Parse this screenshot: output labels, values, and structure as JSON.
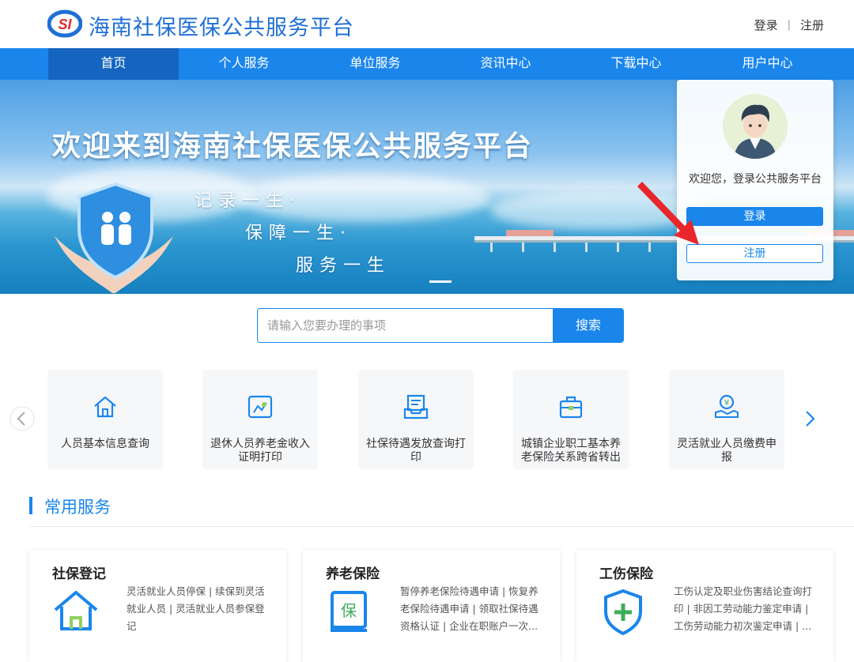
{
  "header": {
    "title": "海南社保医保公共服务平台",
    "logo_text": "SI",
    "login": "登录",
    "separator": "|",
    "register": "注册"
  },
  "nav": {
    "items": [
      "首页",
      "个人服务",
      "单位服务",
      "资讯中心",
      "下载中心",
      "用户中心"
    ],
    "active_index": 0
  },
  "banner": {
    "title": "欢迎来到海南社保医保公共服务平台",
    "slogans": [
      "记录一生·",
      "保障一生·",
      "服务一生"
    ]
  },
  "login_card": {
    "welcome": "欢迎您，登录公共服务平台",
    "login_button": "登录",
    "register_button": "注册"
  },
  "search": {
    "placeholder": "请输入您要办理的事项",
    "button": "搜索"
  },
  "quick_services": [
    {
      "label": "人员基本信息查询",
      "icon": "home-icon"
    },
    {
      "label": "退休人员养老金收入证明打印",
      "icon": "certificate-icon"
    },
    {
      "label": "社保待遇发放查询打印",
      "icon": "document-tray-icon"
    },
    {
      "label": "城镇企业职工基本养老保险关系跨省转出",
      "icon": "briefcase-icon"
    },
    {
      "label": "灵活就业人员缴费申报",
      "icon": "yuan-hand-icon"
    }
  ],
  "common_services": {
    "title": "常用服务",
    "cards": [
      {
        "title": "社保登记",
        "desc": "灵活就业人员停保 | 续保到灵活就业人员 | 灵活就业人员参保登记",
        "icon": "house-icon"
      },
      {
        "title": "养老保险",
        "desc": "暂停养老保险待遇申请 | 恢复养老保险待遇申请 | 领取社保待遇资格认证 | 企业在职账户一次...",
        "icon": "pension-book-icon"
      },
      {
        "title": "工伤保险",
        "desc": "工伤认定及职业伤害结论查询打印 | 非因工劳动能力鉴定申请 | 工伤劳动能力初次鉴定申请 | ...",
        "icon": "shield-plus-icon"
      }
    ]
  },
  "colors": {
    "primary": "#1a86ec",
    "nav_active": "#1565c0",
    "title_blue": "#1f6fd6",
    "arrow_red": "#e8262b"
  }
}
